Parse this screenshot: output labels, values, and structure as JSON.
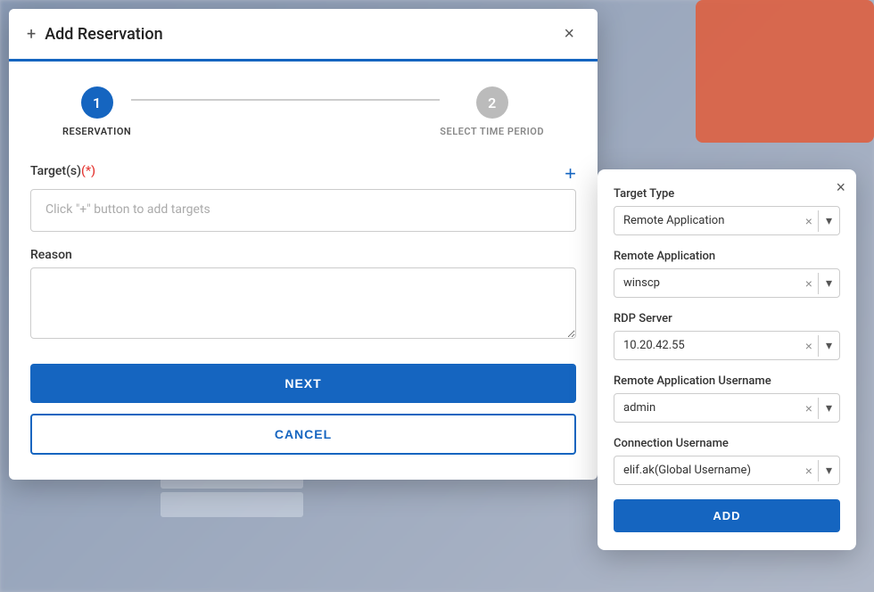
{
  "background": {
    "rows": [
      "",
      "",
      ""
    ]
  },
  "dialog": {
    "title": "Add Reservation",
    "plus_icon": "+",
    "close_icon": "×",
    "stepper": {
      "step1": {
        "number": "1",
        "label": "RESERVATION",
        "state": "active"
      },
      "step2": {
        "number": "2",
        "label": "SELECT TIME PERIOD",
        "state": "inactive"
      }
    },
    "targets_label": "Target(s)",
    "targets_required": "(*)",
    "targets_placeholder": "Click \"+\" button to add targets",
    "reason_label": "Reason",
    "reason_value": "",
    "reason_placeholder": "",
    "next_button": "NEXT",
    "cancel_button": "CANCEL"
  },
  "side_panel": {
    "close_icon": "×",
    "target_type": {
      "label": "Target Type",
      "value": "Remote Application",
      "clear_icon": "×",
      "arrow_icon": "▾"
    },
    "remote_application": {
      "label": "Remote Application",
      "value": "winscp",
      "clear_icon": "×",
      "arrow_icon": "▾"
    },
    "rdp_server": {
      "label": "RDP Server",
      "value": "10.20.42.55",
      "clear_icon": "×",
      "arrow_icon": "▾"
    },
    "remote_app_username": {
      "label": "Remote Application Username",
      "value": "admin",
      "clear_icon": "×",
      "arrow_icon": "▾"
    },
    "connection_username": {
      "label": "Connection Username",
      "value": "elif.ak(Global Username)",
      "clear_icon": "×",
      "arrow_icon": "▾"
    },
    "add_button": "ADD"
  }
}
